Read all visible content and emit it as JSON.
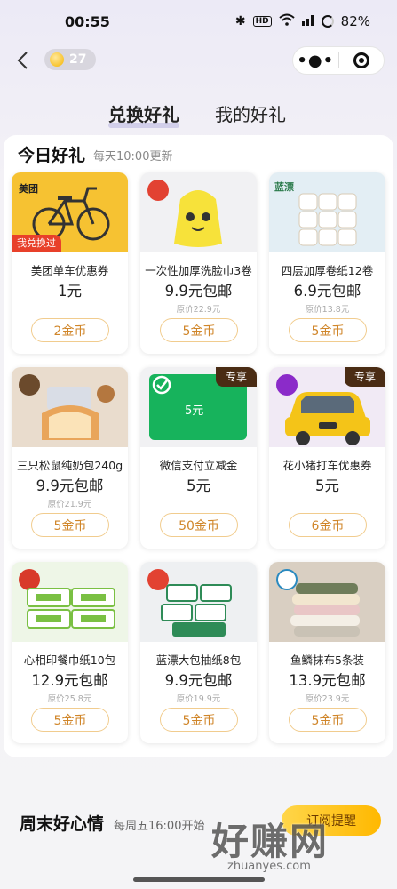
{
  "status_bar": {
    "time": "00:55",
    "battery": "82%",
    "hd": "HD"
  },
  "nav": {
    "coin_count": "27"
  },
  "tabs": {
    "exchange": "兑换好礼",
    "my_gifts": "我的好礼"
  },
  "today": {
    "title": "今日好礼",
    "subtitle": "每天10:00更新"
  },
  "cards": [
    {
      "name": "美团单车优惠券",
      "price": "1元",
      "orig": "",
      "cost": "2金币",
      "badge": "我兑换过",
      "brand": "美团"
    },
    {
      "name": "一次性加厚洗脸巾3卷",
      "price": "9.9元包邮",
      "orig": "原价22.9元",
      "cost": "5金币"
    },
    {
      "name": "四层加厚卷纸12卷",
      "price": "6.9元包邮",
      "orig": "原价13.8元",
      "cost": "5金币",
      "brand": "蓝漂"
    },
    {
      "name": "三只松鼠纯奶包240g",
      "price": "9.9元包邮",
      "orig": "原价21.9元",
      "cost": "5金币"
    },
    {
      "name": "微信支付立减金",
      "price": "5元",
      "orig": "",
      "cost": "50金币",
      "badge": "专享",
      "voucher": "5元"
    },
    {
      "name": "花小猪打车优惠券",
      "price": "5元",
      "orig": "",
      "cost": "6金币",
      "badge": "专享"
    },
    {
      "name": "心相印餐巾纸10包",
      "price": "12.9元包邮",
      "orig": "原价25.8元",
      "cost": "5金币"
    },
    {
      "name": "蓝漂大包抽纸8包",
      "price": "9.9元包邮",
      "orig": "原价19.9元",
      "cost": "5金币"
    },
    {
      "name": "鱼鳞抹布5条装",
      "price": "13.9元包邮",
      "orig": "原价23.9元",
      "cost": "5金币"
    }
  ],
  "weekend": {
    "title": "周末好心情",
    "subtitle": "每周五16:00开始",
    "button": "订阅提醒"
  },
  "watermark": {
    "main": "好赚网",
    "sub": "zhuanyes.com"
  },
  "colors": {
    "accent": "#d0862a",
    "badge_red": "#e8402a",
    "badge_dark": "#4a2c14"
  }
}
